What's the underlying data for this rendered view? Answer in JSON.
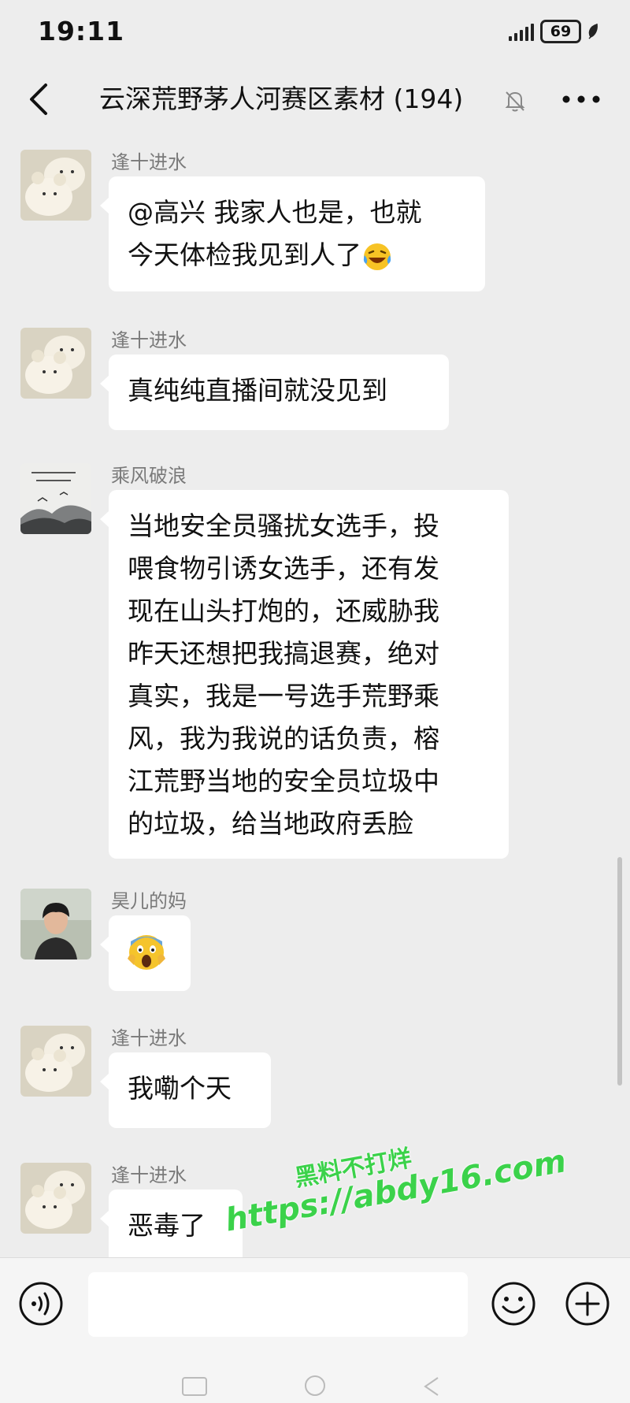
{
  "status_bar": {
    "time": "19:11",
    "battery": "69"
  },
  "header": {
    "title": "云深荒野茅人河赛区素材",
    "member_count": "(194)"
  },
  "messages": [
    {
      "sender": "逢十进水",
      "lines": [
        "@高兴 我家人也是，也就",
        "今天体检我见到人了"
      ],
      "emoji": "grinning-face-with-tears-emoji"
    },
    {
      "sender": "逢十进水",
      "lines": [
        "真纯纯直播间就没见到"
      ]
    },
    {
      "sender": "乘风破浪",
      "lines": [
        "当地安全员骚扰女选手，投",
        "喂食物引诱女选手，还有发",
        "现在山头打炮的，还威胁我",
        "昨天还想把我搞退赛，绝对",
        "真实，我是一号选手荒野乘",
        "风，我为我说的话负责，榕",
        "江荒野当地的安全员垃圾中",
        "的垃圾，给当地政府丢脸"
      ]
    },
    {
      "sender": "昊儿的妈",
      "emoji": "face-screaming-in-fear-emoji"
    },
    {
      "sender": "逢十进水",
      "lines": [
        "我嘞个天"
      ]
    },
    {
      "sender": "逢十进水",
      "lines": [
        "恶毒了"
      ]
    }
  ],
  "watermark": {
    "line1": "黑料不打烊",
    "line2": "https://abdy16.com"
  },
  "input_bar": {
    "placeholder": ""
  },
  "icons": {
    "back": "back-arrow-icon",
    "mute": "mute-bell-icon",
    "more": "more-dots-icon",
    "voice": "voice-icon",
    "emoji": "emoji-icon",
    "plus": "plus-icon"
  },
  "colors": {
    "background": "#ededed",
    "bubble": "#ffffff",
    "sender_name": "#7a7a7a",
    "watermark": "#3bd24a"
  }
}
